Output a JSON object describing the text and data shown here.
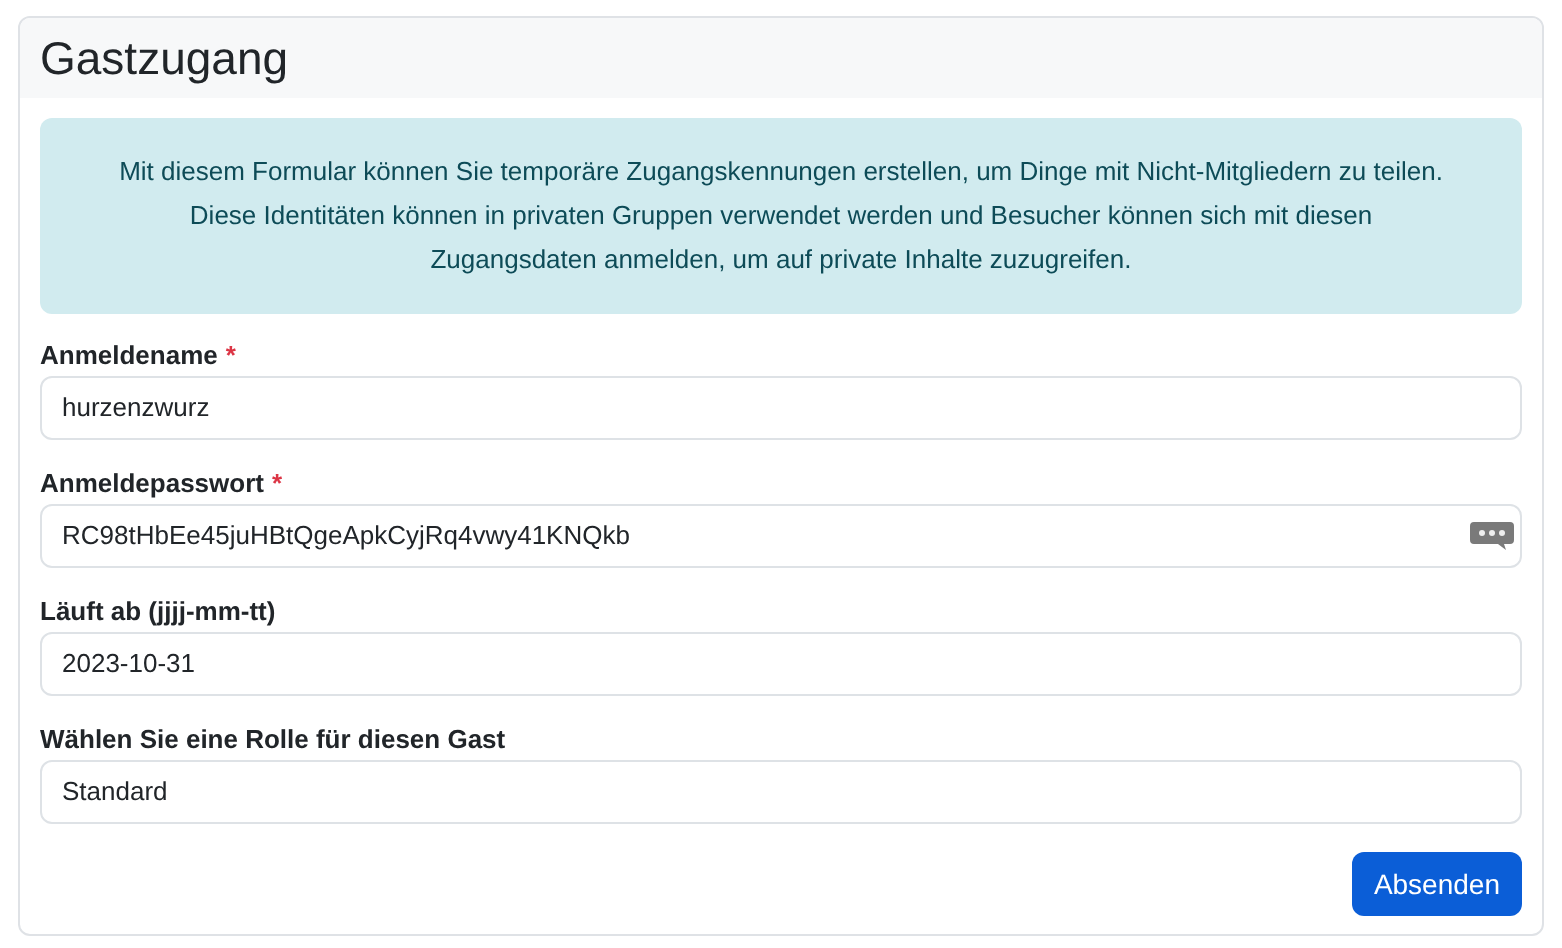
{
  "card": {
    "title": "Gastzugang"
  },
  "info": "Mit diesem Formular können Sie temporäre Zugangskennungen erstellen, um Dinge mit Nicht-Mitgliedern zu teilen. Diese Identitäten können in privaten Gruppen verwendet werden und Besucher können sich mit diesen Zugangsdaten anmelden, um auf private Inhalte zuzugreifen.",
  "fields": [
    {
      "label": "Anmeldename",
      "required_mark": "*",
      "value": "hurzenzwurz",
      "kind": "text"
    },
    {
      "label": "Anmeldepasswort",
      "required_mark": "*",
      "value": "RC98tHbEe45juHBtQgeApkCyjRq4vwy41KNQkb",
      "kind": "password"
    },
    {
      "label": "Läuft ab (jjjj-mm-tt)",
      "value": "2023-10-31",
      "kind": "text"
    },
    {
      "label": "Wählen Sie eine Rolle für diesen Gast",
      "value": "Standard",
      "kind": "text"
    }
  ],
  "submit": "Absenden"
}
